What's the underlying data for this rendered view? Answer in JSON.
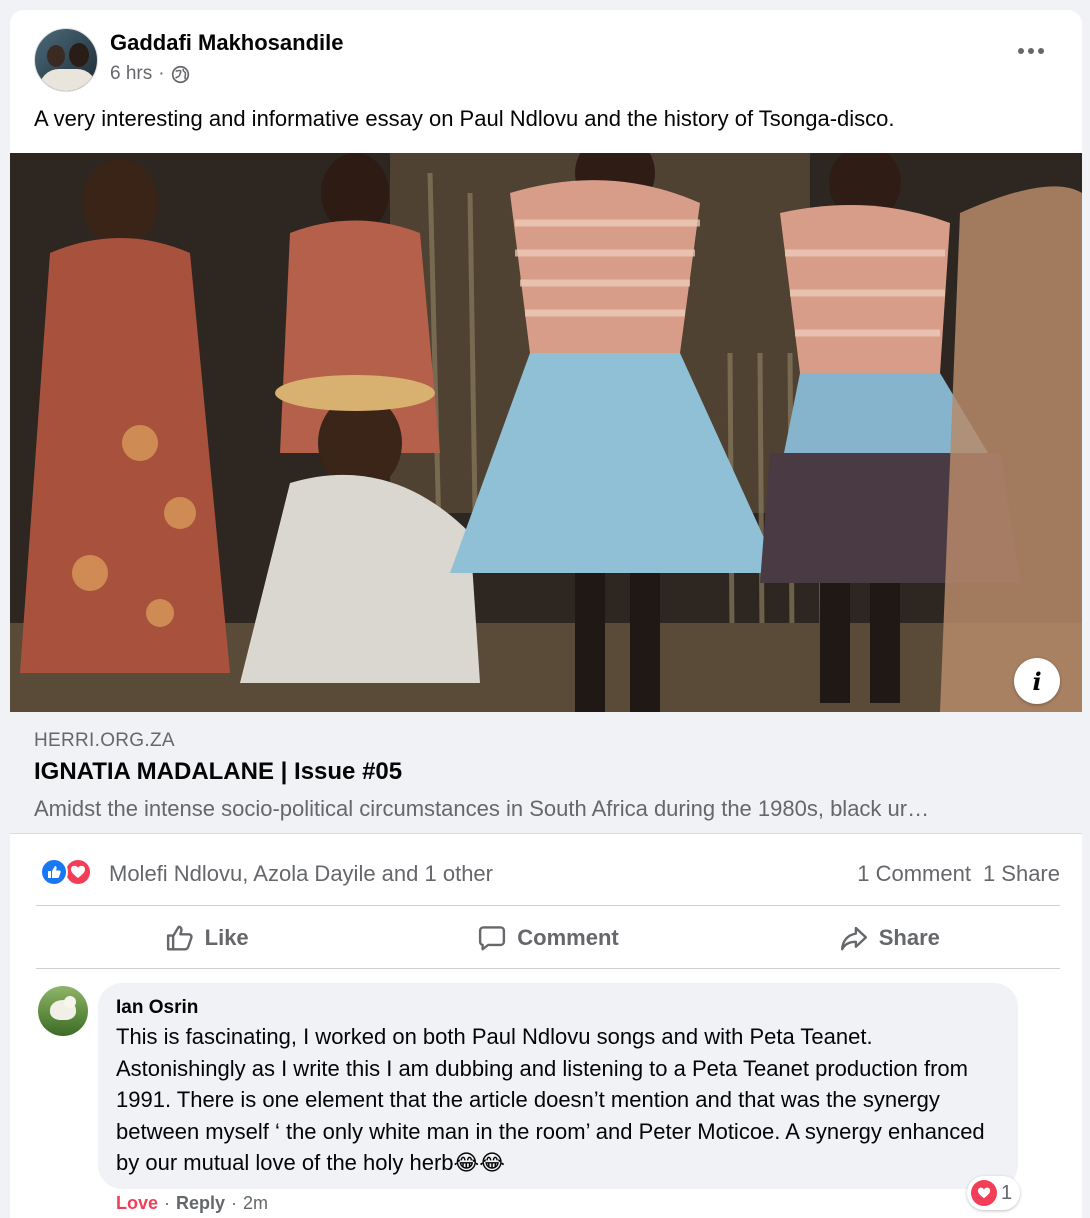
{
  "post": {
    "author": "Gaddafi Makhosandile",
    "time": "6 hrs",
    "separator": "·",
    "privacy_icon": "globe-icon",
    "more_icon": "more-horizontal-icon",
    "text": "A very interesting and informative essay on Paul Ndlovu and the history of Tsonga-disco."
  },
  "link_preview": {
    "image_description_icon": "info-icon",
    "info_glyph": "i",
    "domain": "HERRI.ORG.ZA",
    "title": "IGNATIA MADALANE | Issue #05",
    "description": "Amidst the intense socio-political circumstances in South Africa during the 1980s, black ur…"
  },
  "engagement": {
    "reaction_icons": [
      "like-icon",
      "love-icon"
    ],
    "reactors": "Molefi Ndlovu, Azola Dayile and 1 other",
    "comments": "1 Comment",
    "shares": "1 Share"
  },
  "actions": {
    "like": "Like",
    "comment": "Comment",
    "share": "Share"
  },
  "comment": {
    "author": "Ian Osrin",
    "text": "This is fascinating, I worked on both Paul Ndlovu songs and with Peta Teanet. Astonishingly as I write this I am dubbing and listening to a Peta Teanet production from 1991. There is one element that the article doesn’t mention and that was the synergy between myself ‘ the only white man in the room’ and Peter Moticoe. A synergy enhanced by our mutual love of the holy herb😂😂",
    "reaction_count": "1",
    "reaction_icon": "love-icon",
    "footer": {
      "love": "Love",
      "reply": "Reply",
      "time": "2m",
      "sep": "·"
    }
  },
  "colors": {
    "facebook_blue": "#1877f2",
    "love_red": "#f33e58",
    "secondary_text": "#65676b",
    "background": "#f0f2f5"
  }
}
